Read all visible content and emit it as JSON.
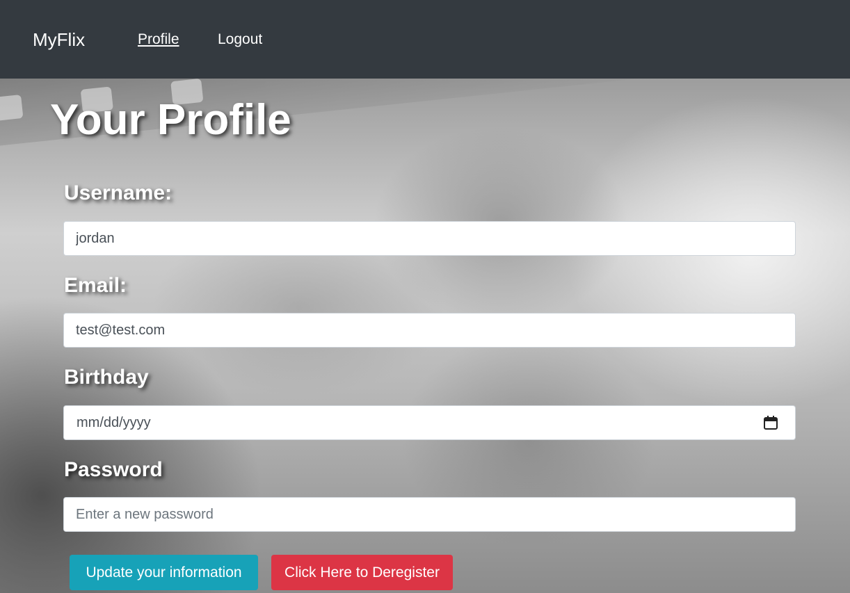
{
  "nav": {
    "brand": "MyFlix",
    "links": [
      {
        "label": "Profile"
      },
      {
        "label": "Logout"
      }
    ]
  },
  "page": {
    "title": "Your Profile"
  },
  "form": {
    "username": {
      "label": "Username:",
      "value": "jordan"
    },
    "email": {
      "label": "Email:",
      "value": "test@test.com"
    },
    "birthday": {
      "label": "Birthday",
      "placeholder": "mm/dd/yyyy",
      "icon": "calendar-icon"
    },
    "password": {
      "label": "Password",
      "placeholder": "Enter a new password",
      "value": ""
    }
  },
  "buttons": {
    "update": "Update your information",
    "deregister": "Click Here to Deregister"
  },
  "colors": {
    "navbar": "#343a40",
    "update_button": "#17a2b8",
    "deregister_button": "#dc3545"
  }
}
